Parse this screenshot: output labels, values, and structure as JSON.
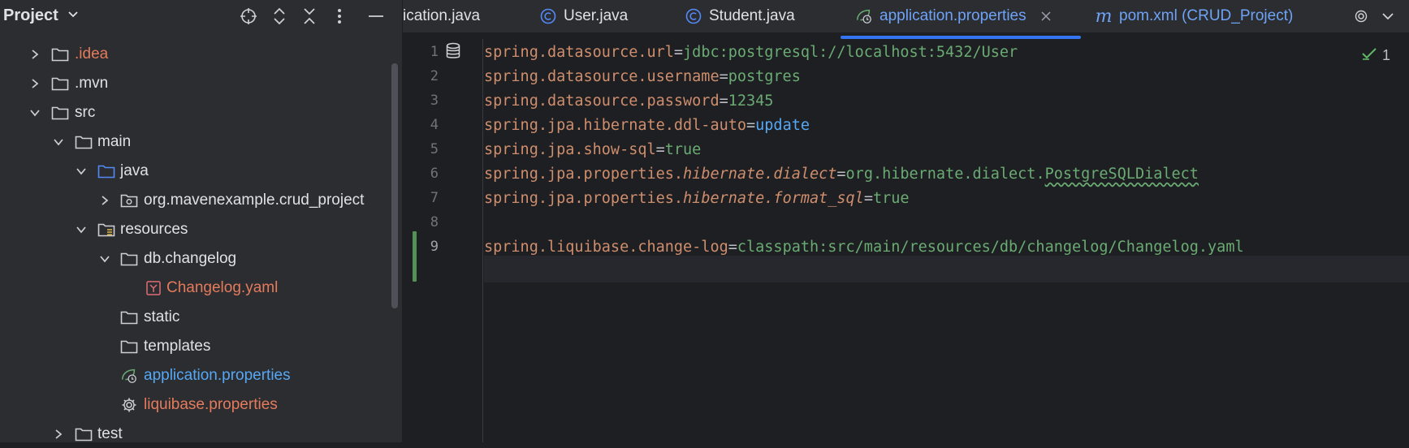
{
  "sidebar": {
    "title": "Project",
    "tree": [
      {
        "label": ".idea",
        "color": "#e57b5c"
      },
      {
        "label": ".mvn",
        "color": "#dfe1e5"
      },
      {
        "label": "src",
        "color": "#dfe1e5"
      },
      {
        "label": "main",
        "color": "#dfe1e5"
      },
      {
        "label": "java",
        "color": "#dfe1e5"
      },
      {
        "label": "org.mavenexample.crud_project",
        "color": "#dfe1e5"
      },
      {
        "label": "resources",
        "color": "#dfe1e5"
      },
      {
        "label": "db.changelog",
        "color": "#dfe1e5"
      },
      {
        "label": "Changelog.yaml",
        "color": "#e57b5c"
      },
      {
        "label": "static",
        "color": "#dfe1e5"
      },
      {
        "label": "templates",
        "color": "#dfe1e5"
      },
      {
        "label": "application.properties",
        "color": "#56a8f5"
      },
      {
        "label": "liquibase.properties",
        "color": "#e57b5c"
      },
      {
        "label": "test",
        "color": "#dfe1e5"
      }
    ]
  },
  "tabs": [
    {
      "label": "ication.java"
    },
    {
      "label": "User.java"
    },
    {
      "label": "Student.java"
    },
    {
      "label": "application.properties"
    },
    {
      "label": "pom.xml (CRUD_Project)"
    }
  ],
  "editor": {
    "line_numbers": [
      "1",
      "2",
      "3",
      "4",
      "5",
      "6",
      "7",
      "8",
      "9"
    ],
    "lines": [
      {
        "key": "spring.datasource.url",
        "value": "jdbc:postgresql://localhost:5432/User"
      },
      {
        "key": "spring.datasource.username",
        "value": "postgres"
      },
      {
        "key": "spring.datasource.password",
        "value": "12345"
      },
      {
        "key": "spring.jpa.hibernate.ddl-auto",
        "value": "update"
      },
      {
        "key": "spring.jpa.show-sql",
        "value": "true"
      },
      {
        "key_a": "spring.jpa.properties.",
        "key_b": "hibernate.dialect",
        "value_a": "org.hibernate.dialect.",
        "value_b": "PostgreSQLDialect"
      },
      {
        "key_a": "spring.jpa.properties.",
        "key_b": "hibernate.format_sql",
        "value": "true"
      },
      {},
      {
        "key": "spring.liquibase.change-log",
        "value": "classpath:src/main/resources/db/changelog/Changelog.yaml"
      }
    ],
    "equals": "=",
    "inspection_count": "1"
  },
  "colors": {
    "key": "#cf8e6d",
    "value": "#6aab73",
    "keyword": "#56a8f5",
    "accent": "#3574f0",
    "modified": "#549159"
  }
}
